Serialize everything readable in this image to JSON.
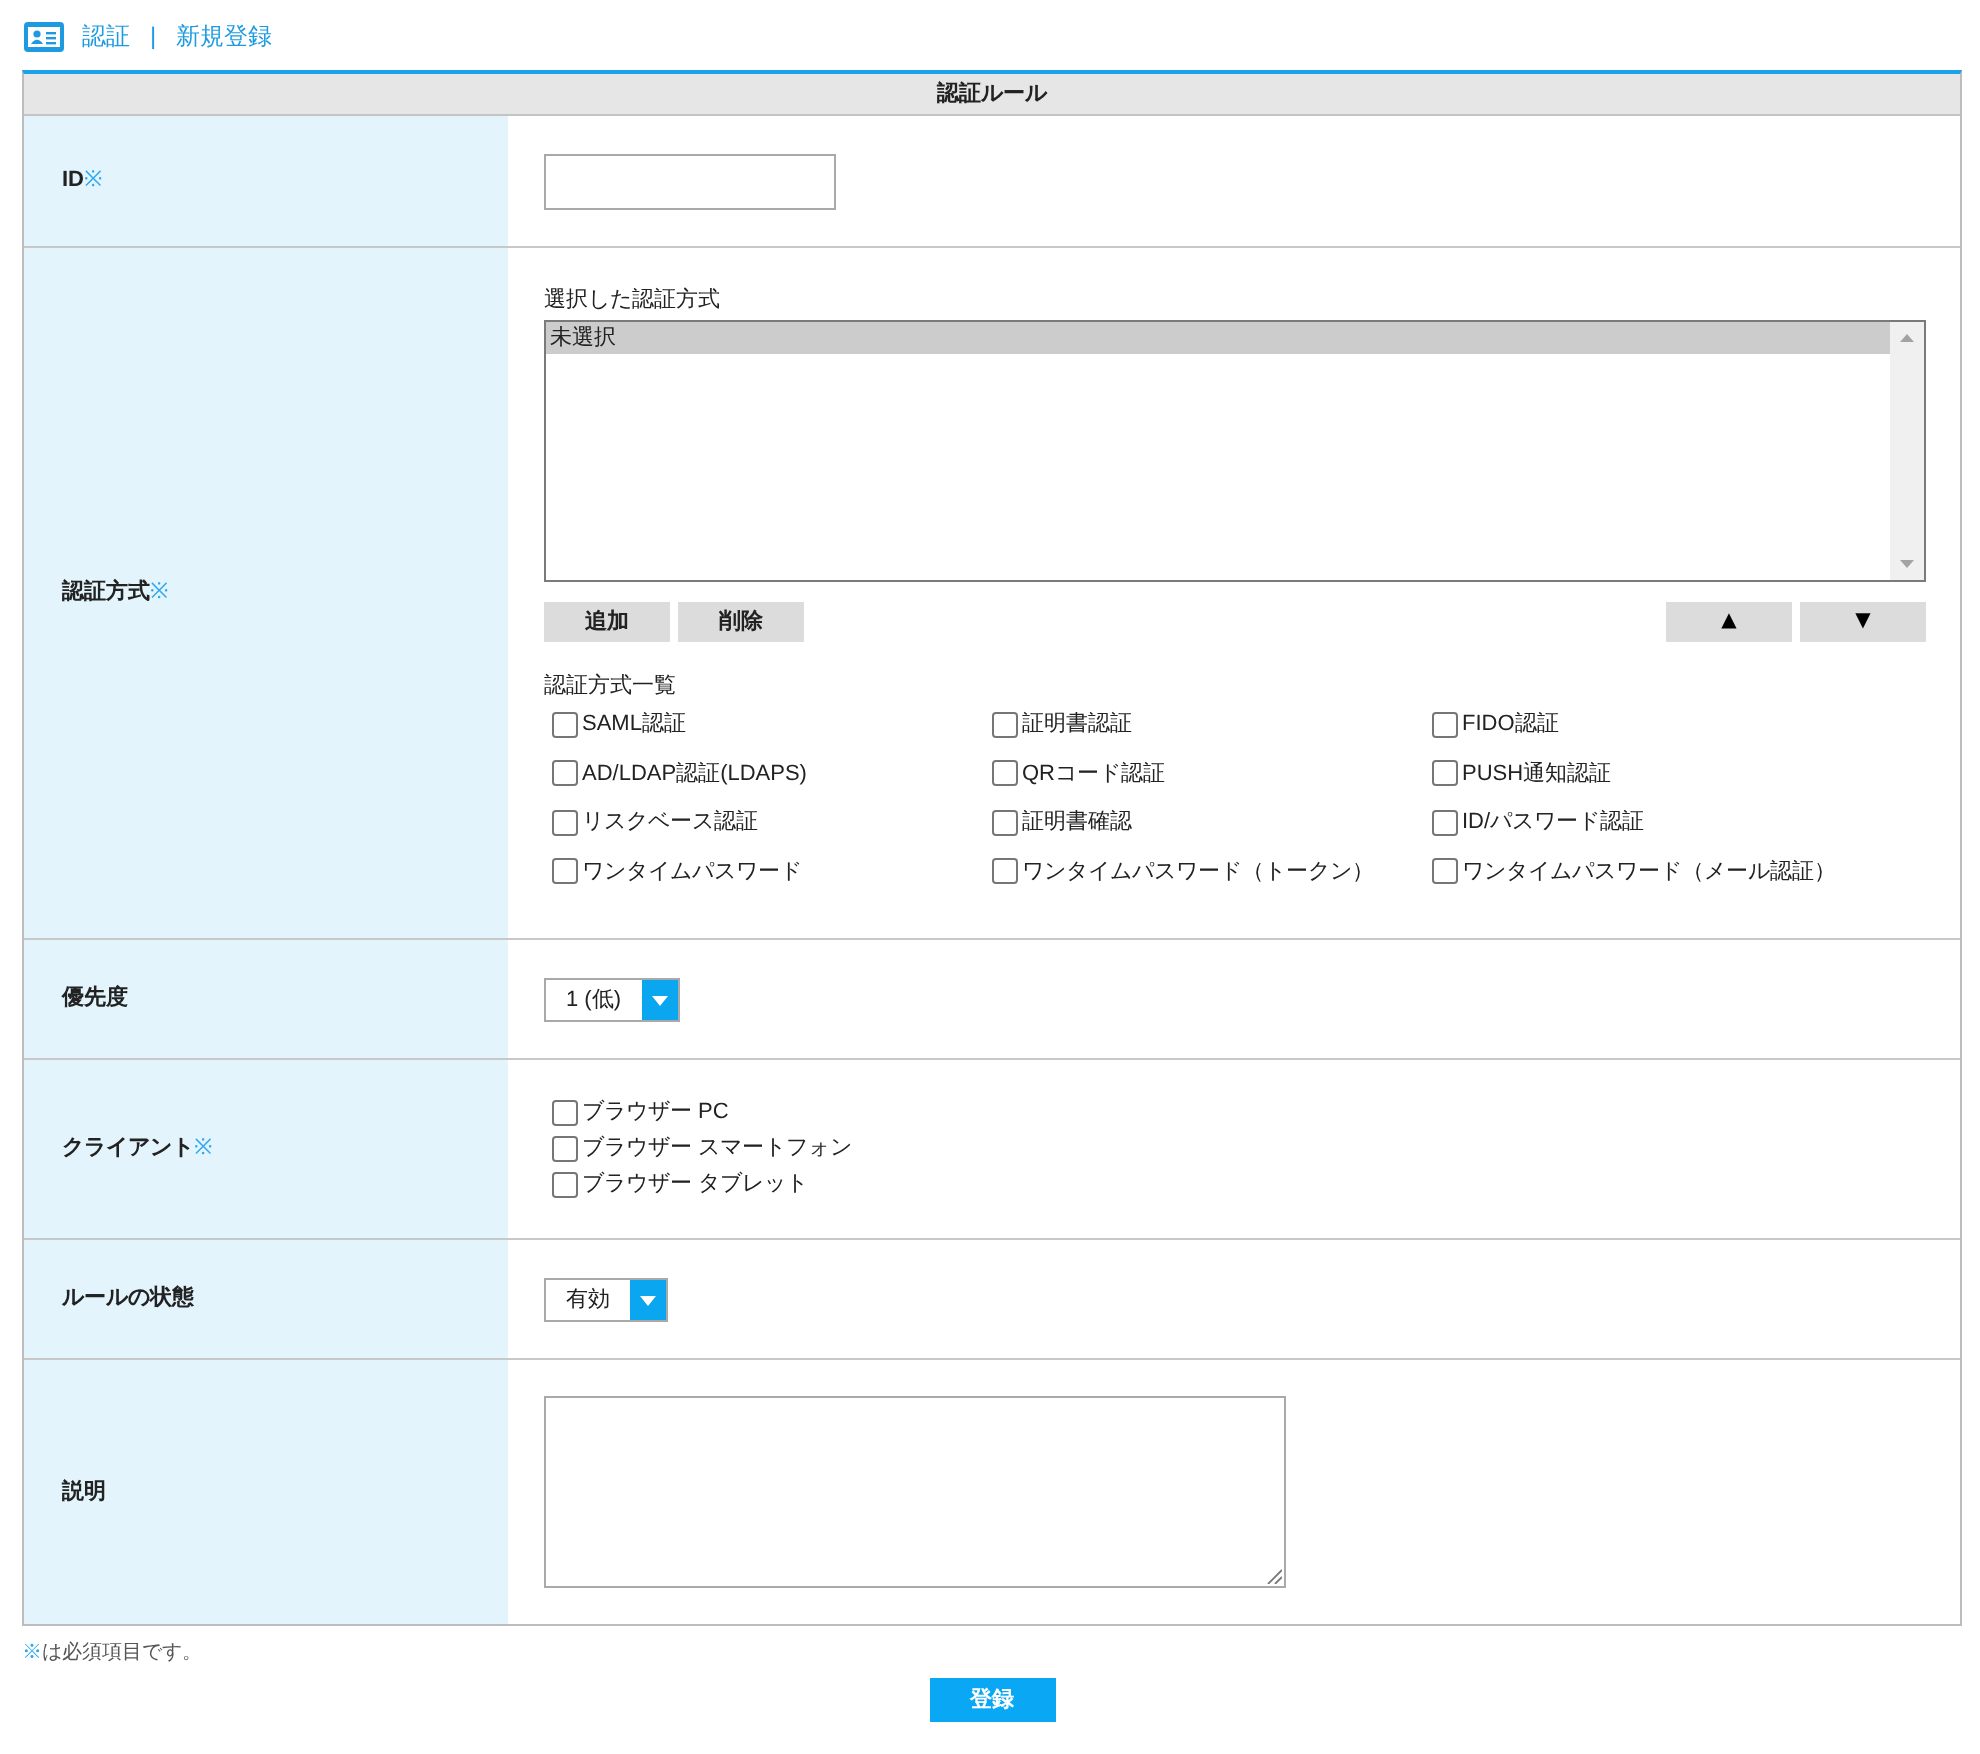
{
  "breadcrumb": {
    "items": [
      {
        "label": "認証"
      },
      {
        "label": "新規登録"
      }
    ],
    "separator": "|"
  },
  "form": {
    "title": "認証ルール",
    "rows": [
      {
        "kind": "text_input",
        "label": "ID",
        "required_mark": "※"
      },
      {
        "kind": "auth_methods",
        "label": "認証方式",
        "required_mark": "※",
        "selected_caption": "選択した認証方式",
        "selected_methods": [
          {
            "label": "未選択",
            "selected": true
          }
        ],
        "edit_buttons": [
          "追加",
          "削除"
        ],
        "order_buttons": [
          "▲",
          "▼"
        ],
        "catalog_caption": "認証方式一覧",
        "catalog": [
          {
            "label": "SAML認証",
            "checked": false
          },
          {
            "label": "証明書認証",
            "checked": false
          },
          {
            "label": "FIDO認証",
            "checked": false
          },
          {
            "label": "AD/LDAP認証(LDAPS)",
            "checked": false
          },
          {
            "label": "QRコード認証",
            "checked": false
          },
          {
            "label": "PUSH通知認証",
            "checked": false
          },
          {
            "label": "リスクベース認証",
            "checked": false
          },
          {
            "label": "証明書確認",
            "checked": false
          },
          {
            "label": "ID/パスワード認証",
            "checked": false
          },
          {
            "label": "ワンタイムパスワード",
            "checked": false
          },
          {
            "label": "ワンタイムパスワード（トークン）",
            "checked": false
          },
          {
            "label": "ワンタイムパスワード（メール認証）",
            "checked": false
          }
        ]
      },
      {
        "kind": "select",
        "label": "優先度",
        "value": "1 (低)"
      },
      {
        "kind": "checkbox_list",
        "label": "クライアント",
        "required_mark": "※",
        "options": [
          {
            "label": "ブラウザー PC",
            "checked": false
          },
          {
            "label": "ブラウザー スマートフォン",
            "checked": false
          },
          {
            "label": "ブラウザー タブレット",
            "checked": false
          }
        ]
      },
      {
        "kind": "select",
        "label": "ルールの状態",
        "value": "有効"
      },
      {
        "kind": "textarea",
        "label": "説明"
      }
    ]
  },
  "note": {
    "mark": "※",
    "text": "は必須項目です。"
  },
  "submit_button": "登録"
}
